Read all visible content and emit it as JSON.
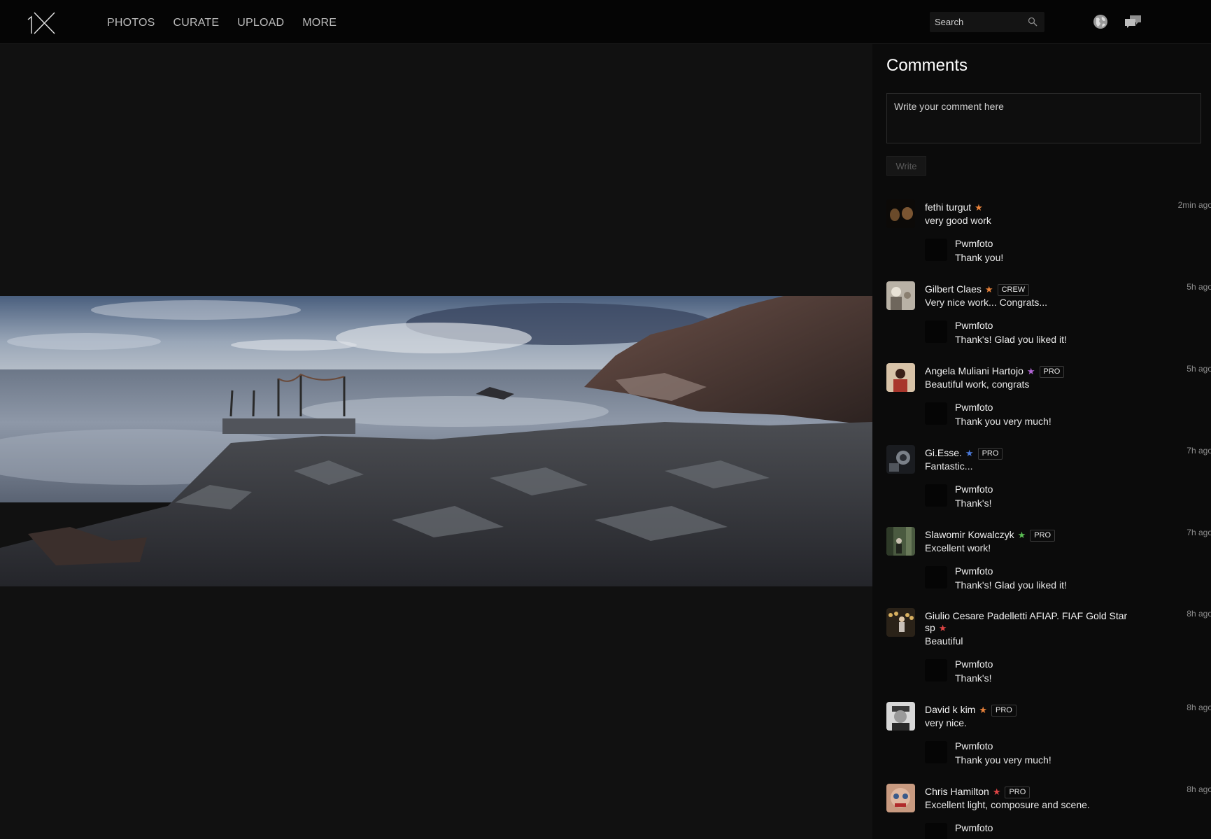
{
  "nav": {
    "items": [
      {
        "label": "PHOTOS"
      },
      {
        "label": "CURATE"
      },
      {
        "label": "UPLOAD"
      },
      {
        "label": "MORE"
      }
    ],
    "search_placeholder": "Search"
  },
  "colors": {
    "background": "#111111",
    "topbar": "#050505",
    "sidebar": "#0b0b0b",
    "star_orange": "#e8823a",
    "star_purple": "#b266d6",
    "star_blue": "#4a78d8",
    "star_green": "#5bbf54",
    "star_red": "#e04545"
  },
  "comments_panel": {
    "title": "Comments",
    "input_placeholder": "Write your comment here",
    "write_label": "Write"
  },
  "comments": [
    {
      "name": "fethi turgut",
      "star_color": "#e8823a",
      "badge": "",
      "time": "2min ago",
      "text": "very good work",
      "reply_name": "Pwmfoto",
      "reply_text": "Thank you!",
      "avatar_icon": "hands-photo"
    },
    {
      "name": "Gilbert Claes",
      "star_color": "#e8823a",
      "badge": "CREW",
      "time": "5h ago",
      "text": "Very nice work... Congrats...",
      "reply_name": "Pwmfoto",
      "reply_text": "Thank's! Glad you liked it!",
      "avatar_icon": "man-portrait"
    },
    {
      "name": "Angela Muliani Hartojo",
      "star_color": "#b266d6",
      "badge": "PRO",
      "time": "5h ago",
      "text": "Beautiful work, congrats",
      "reply_name": "Pwmfoto",
      "reply_text": "Thank you very much!",
      "avatar_icon": "woman-portrait"
    },
    {
      "name": "Gi.Esse.",
      "star_color": "#4a78d8",
      "badge": "PRO",
      "time": "7h ago",
      "text": "Fantastic...",
      "reply_name": "Pwmfoto",
      "reply_text": "Thank's!",
      "avatar_icon": "camera-lens"
    },
    {
      "name": "Slawomir Kowalczyk",
      "star_color": "#5bbf54",
      "badge": "PRO",
      "time": "7h ago",
      "text": "Excellent work!",
      "reply_name": "Pwmfoto",
      "reply_text": "Thank's! Glad you liked it!",
      "avatar_icon": "forest-person"
    },
    {
      "name": "Giulio Cesare Padelletti AFIAP. FIAF Gold Star sp",
      "star_color": "#e04545",
      "badge": "",
      "time": "8h ago",
      "text": "Beautiful",
      "reply_name": "Pwmfoto",
      "reply_text": "Thank's!",
      "avatar_icon": "man-standing"
    },
    {
      "name": "David k kim",
      "star_color": "#e8823a",
      "badge": "PRO",
      "time": "8h ago",
      "text": "very nice.",
      "reply_name": "Pwmfoto",
      "reply_text": "Thank you very much!",
      "avatar_icon": "man-hat-portrait"
    },
    {
      "name": "Chris Hamilton",
      "star_color": "#e04545",
      "badge": "PRO",
      "time": "8h ago",
      "text": "Excellent light, composure and scene.",
      "reply_name": "Pwmfoto",
      "reply_text": "",
      "avatar_icon": "face-closeup"
    }
  ]
}
